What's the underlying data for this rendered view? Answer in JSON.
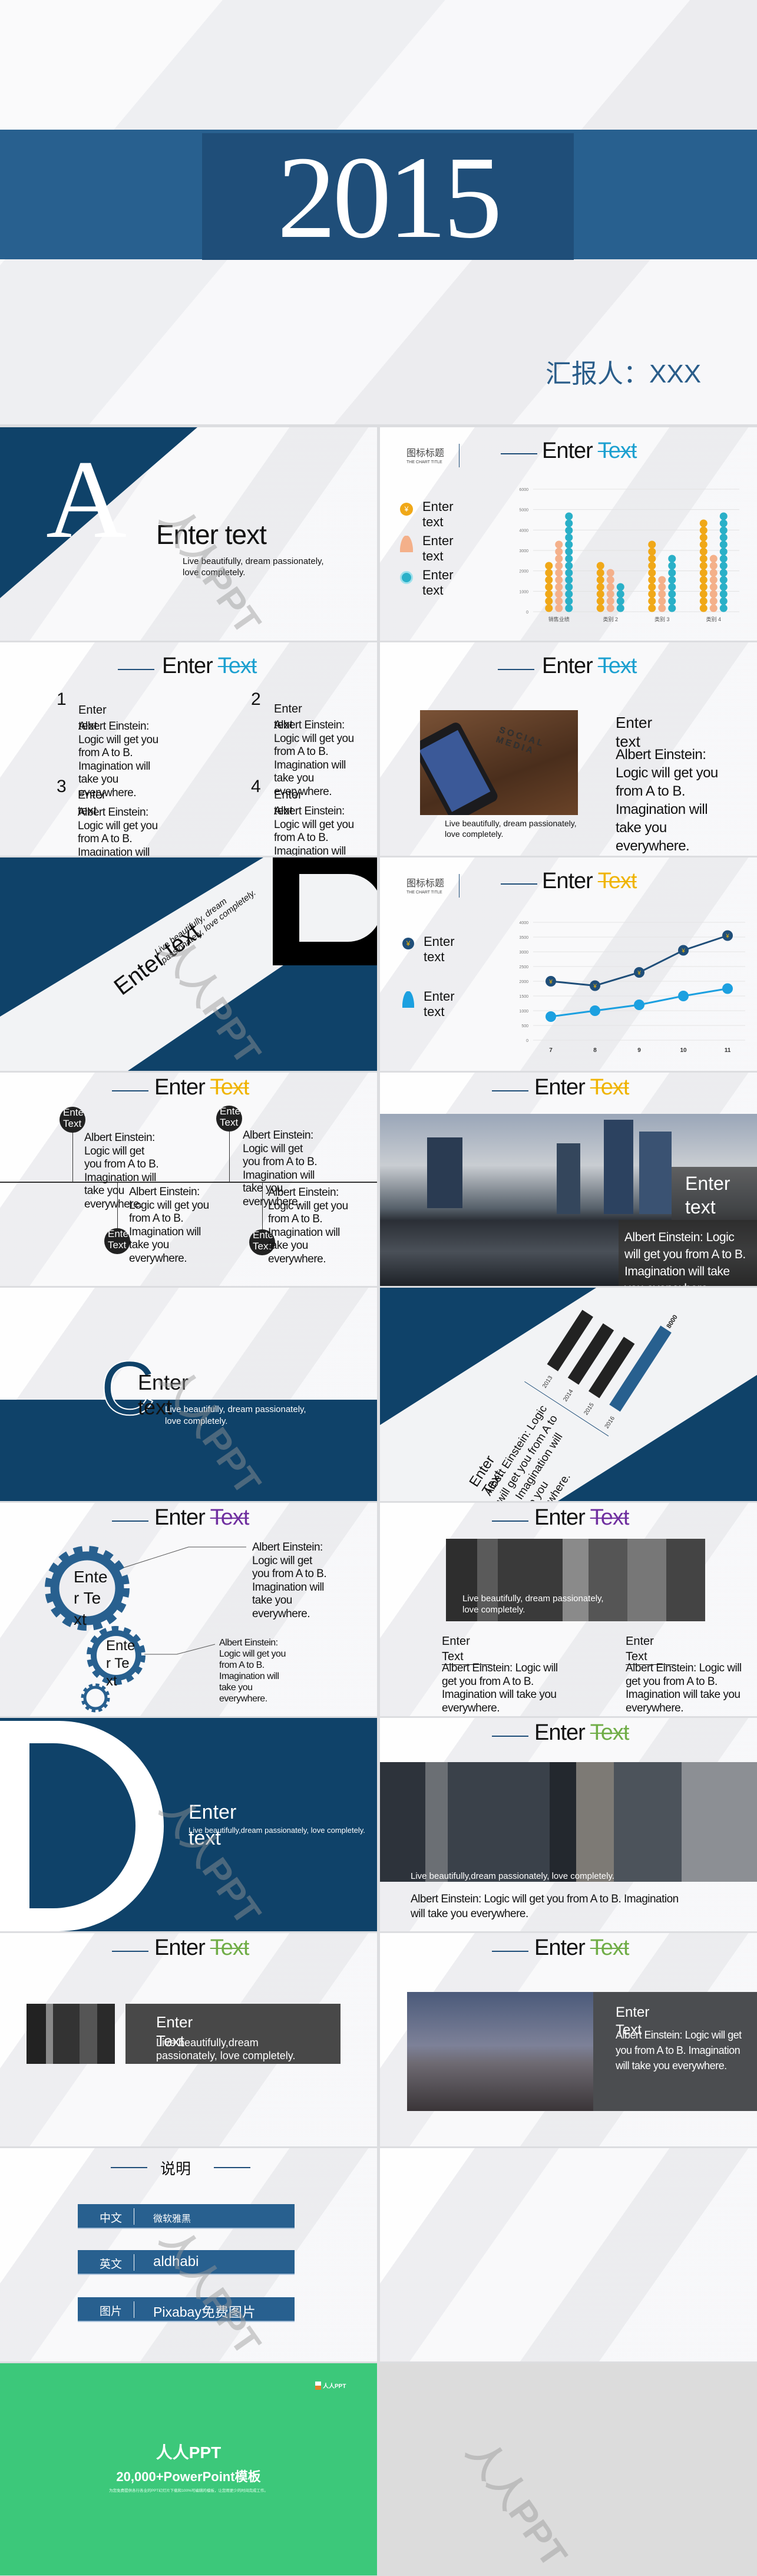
{
  "watermark": "人人PPT",
  "colors": {
    "navy": "#1f4e79",
    "band": "#28608f",
    "accent_blue": "#1ca0d0",
    "accent_yellow": "#f0b400",
    "accent_purple": "#7030a0",
    "accent_green": "#70ad47",
    "end_green": "#3cc87a"
  },
  "title_slide": {
    "year": "2015",
    "presenter": "汇报人：XXX"
  },
  "s_a": {
    "letter": "A",
    "title": "Enter text",
    "subtitle": "Live beautifully, dream passionately, love completely."
  },
  "s_barchart": {
    "chart_title_cn": "图标标题",
    "chart_title_en": "THE CHART TITLE",
    "header_a": "Enter ",
    "header_b": "Text",
    "legend": [
      {
        "label": "Enter text",
        "icon": "yen-coin-icon"
      },
      {
        "label": "Enter text",
        "icon": "person-icon"
      },
      {
        "label": "Enter text",
        "icon": "medal-icon"
      }
    ]
  },
  "s_numbers": {
    "header_a": "Enter ",
    "header_b": "Text",
    "items": [
      {
        "num": "1",
        "title": "Enter text",
        "body": "Albert Einstein: Logic will get you from A to B. Imagination will take you everywhere."
      },
      {
        "num": "2",
        "title": "Enter text",
        "body": "Albert Einstein: Logic will get you from A to B. Imagination will take you everywhere."
      },
      {
        "num": "3",
        "title": "Enter text",
        "body": "Albert Einstein: Logic will get you from A to B. Imagination will take you everywhere."
      },
      {
        "num": "4",
        "title": "Enter text",
        "body": "Albert Einstein: Logic will get you from A to B. Imagination will take you everywhere."
      }
    ]
  },
  "s_phone": {
    "header_a": "Enter ",
    "header_b": "Text",
    "caption": "Live beautifully, dream passionately, love completely.",
    "title": "Enter text",
    "body": "Albert Einstein: Logic will get you from A to B. Imagination will take you everywhere.",
    "photo_text": "SOCIAL MEDIA"
  },
  "s_d1": {
    "letter": "D",
    "title": "Enter text",
    "subtitle": "Live beautifully, dream passionately, love completely."
  },
  "s_linechart": {
    "chart_title_cn": "图标标题",
    "chart_title_en": "THE CHART TITLE",
    "header_a": "Enter ",
    "header_b": "Text",
    "legend": [
      {
        "label": "Enter text",
        "icon": "yen-coin-icon"
      },
      {
        "label": "Enter text",
        "icon": "person-icon"
      }
    ]
  },
  "s_timeline": {
    "header_a": "Enter ",
    "header_b": "Text",
    "items": [
      {
        "circle": "Enter Text",
        "body": "Albert Einstein: Logic will get you from A to B. Imagination will take you everywhere."
      },
      {
        "circle": "Enter Text",
        "body": "Albert Einstein: Logic will get you from A to B. Imagination will take you everywhere."
      },
      {
        "circle": "Enter Text",
        "body": "Albert Einstein: Logic will get you from A to B. Imagination will take you everywhere."
      },
      {
        "circle": "Enter Text",
        "body": "Albert Einstein: Logic will get you from A to B. Imagination will take you everywhere."
      }
    ]
  },
  "s_city": {
    "header_a": "Enter ",
    "header_b": "Text",
    "title": "Enter text",
    "body": "Albert Einstein: Logic will get you from A to B. Imagination will take you everywhere."
  },
  "s_c": {
    "letter": "C",
    "title": "Enter text",
    "subtitle": "Live beautifully, dream passionately, love completely."
  },
  "s_yearbars": {
    "title": "Enter Text",
    "body": "Albert Einstein: Logic will get you from A to B. Imagination will take you everywhere."
  },
  "s_gears": {
    "header_a": "Enter ",
    "header_b": "Text",
    "gear1": "Enter Text",
    "gear2": "Enter Text",
    "text1": "Albert Einstein: Logic will get you from A to B. Imagination will take you everywhere.",
    "text2": "Albert Einstein: Logic will get you from A to B. Imagination will take you everywhere."
  },
  "s_gray": {
    "header_a": "Enter ",
    "header_b": "Text",
    "caption": "Live beautifully, dream passionately, love completely.",
    "cols": [
      {
        "title": "Enter Text",
        "body": "Albert Einstein: Logic will get you from A to B. Imagination will take you everywhere."
      },
      {
        "title": "Enter Text",
        "body": "Albert Einstein: Logic will get you from A to B. Imagination will take you everywhere."
      }
    ]
  },
  "s_d2": {
    "letter": "D",
    "title": "Enter text",
    "subtitle": "Live beautifully,dream passionately, love completely."
  },
  "s_wide": {
    "header_a": "Enter ",
    "header_b": "Text",
    "caption": "Live beautifully,dream passionately, love completely.",
    "body": "Albert Einstein: Logic will get you from A to B. Imagination will take you everywhere."
  },
  "s_box": {
    "header_a": "Enter ",
    "header_b": "Text",
    "title": "Enter Text",
    "caption": "Live beautifully,dream passionately, love completely."
  },
  "s_beach": {
    "header_a": "Enter ",
    "header_b": "Text",
    "title": "Enter Text",
    "body": "Albert Einstein: Logic will get you from A to B. Imagination will take you everywhere."
  },
  "s_notes": {
    "title": "说明",
    "rows": [
      {
        "k": "中文",
        "v": "微软雅黑"
      },
      {
        "k": "英文",
        "v": "aldhabi"
      },
      {
        "k": "图片",
        "v": "Pixabay免费图片"
      }
    ]
  },
  "s_end": {
    "logo": "人人PPT",
    "title": "人人PPT",
    "subtitle": "20,000+PowerPoint模板",
    "note": "为您免费提供各行各业的PPT幻灯片下载和100%可编辑的模板，让您用更少的时间完成工作。"
  },
  "chart_data": [
    {
      "type": "bar",
      "categories": [
        "销售业绩",
        "类别 2",
        "类别 3",
        "类别 4"
      ],
      "series": [
        {
          "values": [
            2400,
            2600,
            3500,
            4500
          ],
          "color": "#f0a818"
        },
        {
          "values": [
            3500,
            2300,
            1800,
            2800
          ],
          "color": "#f4b08a"
        },
        {
          "values": [
            4800,
            1500,
            3000,
            5000
          ],
          "color": "#2ab0c8"
        }
      ],
      "ylim": [
        0,
        6000
      ],
      "yticks": [
        0,
        1000,
        2000,
        3000,
        4000,
        5000,
        6000
      ],
      "grid": true
    },
    {
      "type": "line",
      "x": [
        7,
        8,
        9,
        10,
        11
      ],
      "series": [
        {
          "values": [
            2000,
            1850,
            2300,
            3050,
            3550
          ],
          "color": "#1f4e79"
        },
        {
          "values": [
            800,
            1000,
            1200,
            1500,
            1750
          ],
          "color": "#1ca0e0"
        }
      ],
      "ylim": [
        0,
        4000
      ],
      "yticks": [
        0,
        500,
        1000,
        1500,
        2000,
        2500,
        3000,
        3500,
        4000
      ],
      "grid": true
    },
    {
      "type": "bar",
      "orientation": "horizontal",
      "categories": [
        "2013",
        "2014",
        "2015",
        "2016"
      ],
      "values": [
        5500,
        5500,
        5500,
        8000
      ],
      "data_labels": [
        "",
        "",
        "",
        "8000"
      ]
    }
  ]
}
